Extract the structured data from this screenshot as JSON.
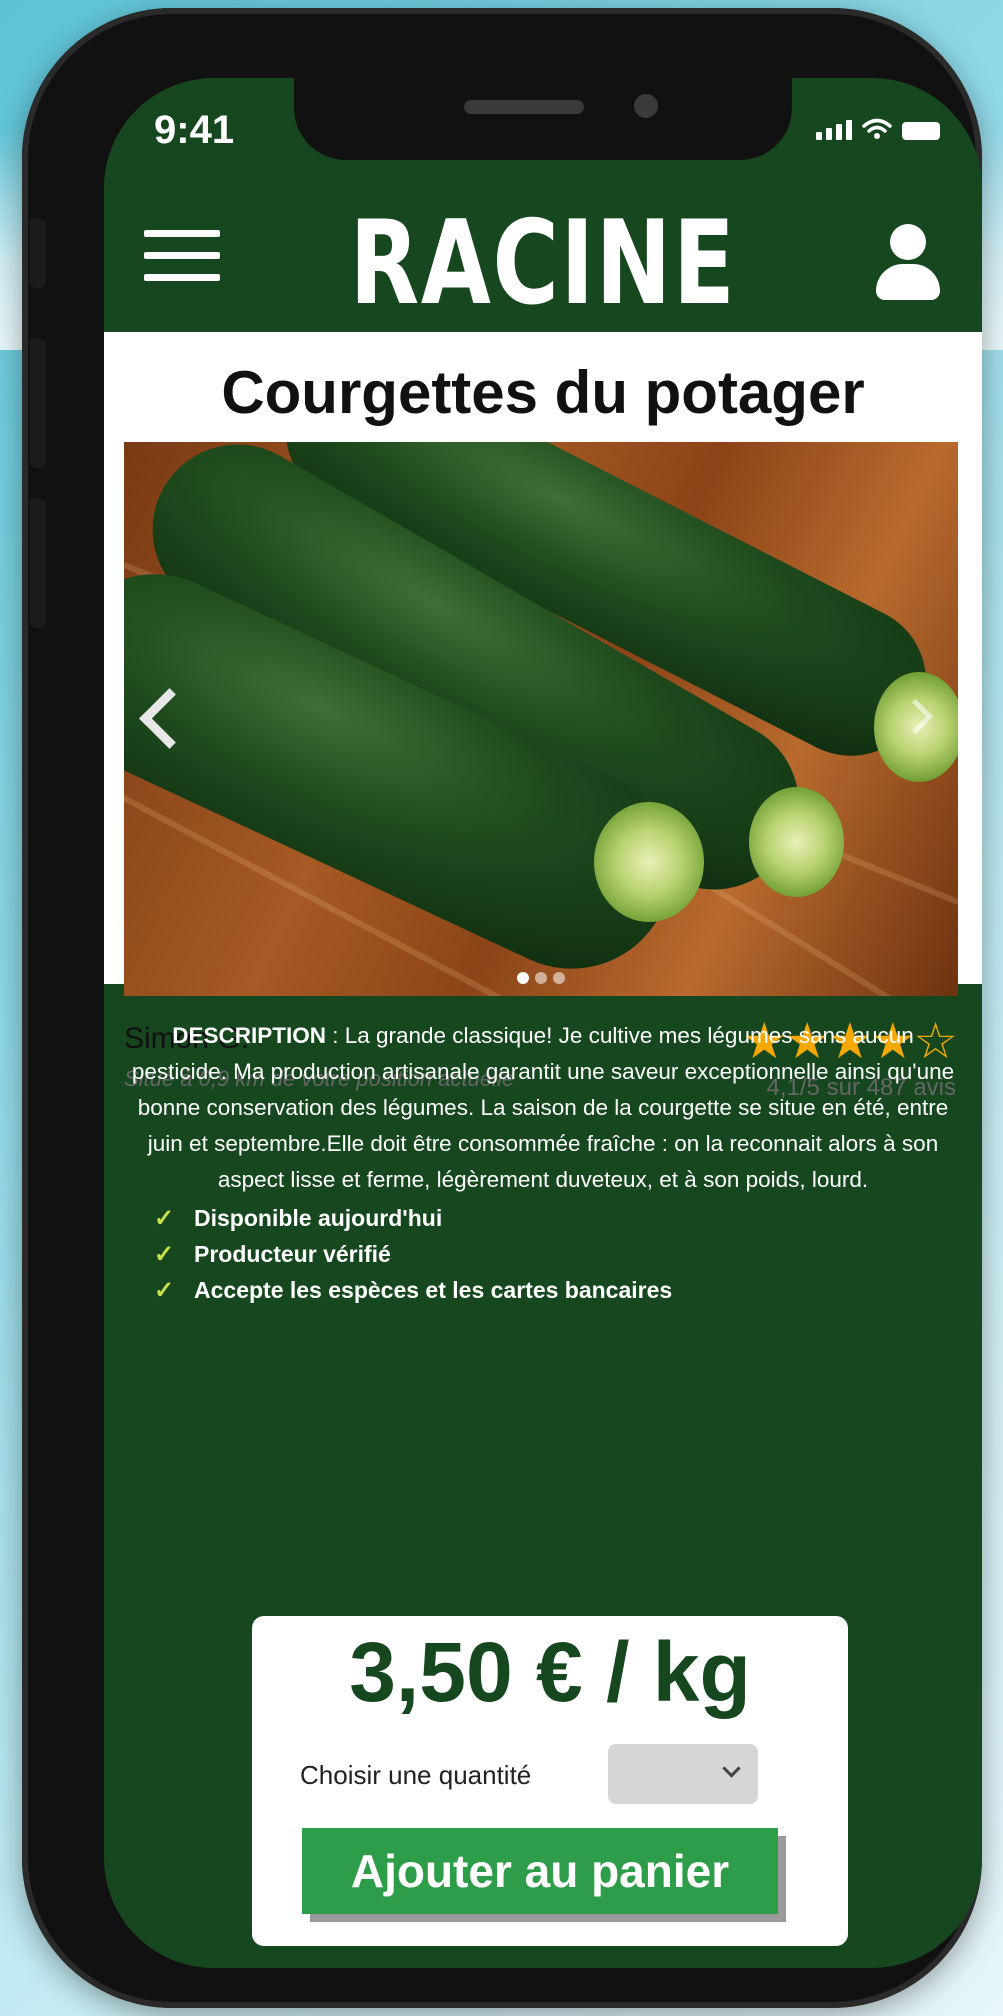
{
  "status_bar": {
    "time": "9:41"
  },
  "header": {
    "logo": "RACINE"
  },
  "product": {
    "title": "Courgettes du potager",
    "seller": "Simon G.",
    "location": "Situé à 0,9 km de votre position actuelle",
    "rating_stars": 4,
    "rating_max": 5,
    "rating_text": "4,1/5 sur 487 avis",
    "carousel_count": 3,
    "carousel_active": 0
  },
  "description": {
    "label": "DESCRIPTION",
    "text": " : La grande classique! Je cultive mes légumes sans aucun pesticide. Ma production artisanale garantit une saveur exceptionnelle ainsi qu'une bonne conservation des légumes. La saison de la courgette se situe en été, entre juin et septembre.Elle doit être consommée fraîche : on la reconnait alors à son aspect lisse et ferme, légèrement duveteux, et à son poids, lourd."
  },
  "features": [
    "Disponible aujourd'hui",
    "Producteur vérifié",
    "Accepte les espèces et les cartes bancaires"
  ],
  "purchase": {
    "price": "3,50 € / kg",
    "quantity_label": "Choisir une quantité",
    "quantity_value": "",
    "add_button": "Ajouter au panier"
  },
  "colors": {
    "brand_green": "#17471f",
    "button_green": "#2e9d4a",
    "star_yellow": "#f5a800",
    "check_green": "#c8e04a"
  }
}
